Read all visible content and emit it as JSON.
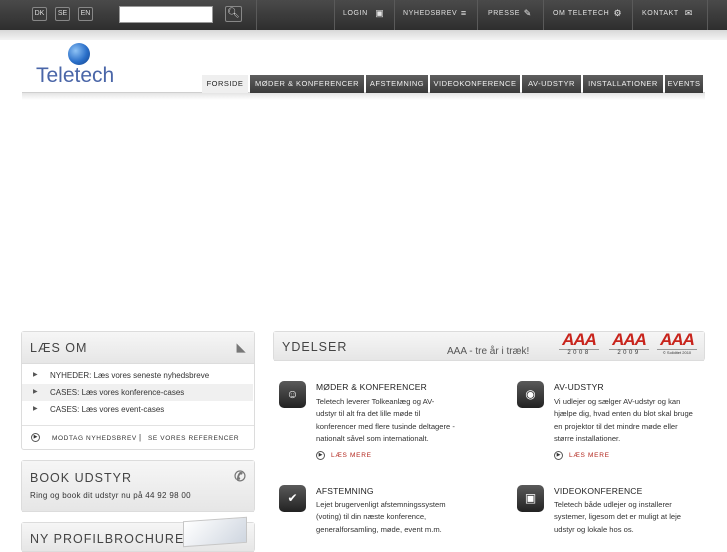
{
  "topbar": {
    "languages": [
      "DK",
      "SE",
      "EN"
    ],
    "search": {
      "value": "",
      "placeholder": ""
    },
    "links": [
      {
        "label": "LOGIN",
        "icon": "lock-icon"
      },
      {
        "label": "NYHEDSBREV",
        "icon": "rss-icon"
      },
      {
        "label": "PRESSE",
        "icon": "pencil-icon"
      },
      {
        "label": "OM TELETECH",
        "icon": "gear-icon"
      },
      {
        "label": "KONTAKT",
        "icon": "mail-icon"
      }
    ]
  },
  "logo": {
    "text": "Teletech"
  },
  "nav": {
    "tabs": [
      "FORSIDE",
      "MØDER & KONFERENCER",
      "AFSTEMNING",
      "VIDEOKONFERENCE",
      "AV-UDSTYR",
      "INSTALLATIONER",
      "EVENTS"
    ],
    "active": "FORSIDE"
  },
  "laes_om": {
    "title": "LÆS OM",
    "items": [
      "NYHEDER: Læs vores seneste nyhedsbreve",
      "CASES: Læs vores konference-cases",
      "CASES: Læs vores event-cases"
    ],
    "links": [
      "MODTAG NYHEDSBREV",
      "SE VORES REFERENCER"
    ],
    "separator": "|"
  },
  "book": {
    "title": "BOOK UDSTYR",
    "text": "Ring og book dit udstyr nu på 44 92 98 00"
  },
  "brochure": {
    "title": "NY PROFILBROCHURE"
  },
  "ydelser": {
    "title": "YDELSER",
    "tagline": "AAA - tre år i træk!",
    "badges": [
      {
        "label": "AAA",
        "year": "2008"
      },
      {
        "label": "AAA",
        "year": "2009"
      },
      {
        "label": "AAA",
        "year": "© Soliditet 2010"
      }
    ],
    "services": [
      {
        "title": "MØDER & KONFERENCER",
        "lines": [
          "Teletech leverer Tolkeanlæg og AV-",
          "udstyr til alt fra det lille møde til",
          "konferencer med flere tusinde deltagere -",
          "nationalt såvel som internationalt."
        ],
        "more": "LÆS MERE",
        "icon": "people-icon"
      },
      {
        "title": "AV-UDSTYR",
        "lines": [
          "Vi udlejer og sælger AV-udstyr og kan",
          "hjælpe dig, hvad enten du blot skal bruge",
          "en projektor til det mindre møde eller",
          "større installationer."
        ],
        "more": "LÆS MERE",
        "icon": "projector-icon"
      },
      {
        "title": "AFSTEMNING",
        "lines": [
          "Lejet brugervenligt afstemningssystem",
          "(voting) til din næste konference,",
          "generalforsamling, møde, event m.m."
        ],
        "more": "LÆS MERE",
        "icon": "checkmark-icon"
      },
      {
        "title": "VIDEOKONFERENCE",
        "lines": [
          "Teletech både udlejer og installerer",
          "systemer, ligesom det er muligt at leje",
          "udstyr og lokale hos os."
        ],
        "more": "LÆS MERE",
        "icon": "monitor-icon"
      }
    ]
  },
  "colors": {
    "accent": "#c8241c",
    "topbar": "#3a3a3a",
    "logo": "#4a66a8"
  }
}
